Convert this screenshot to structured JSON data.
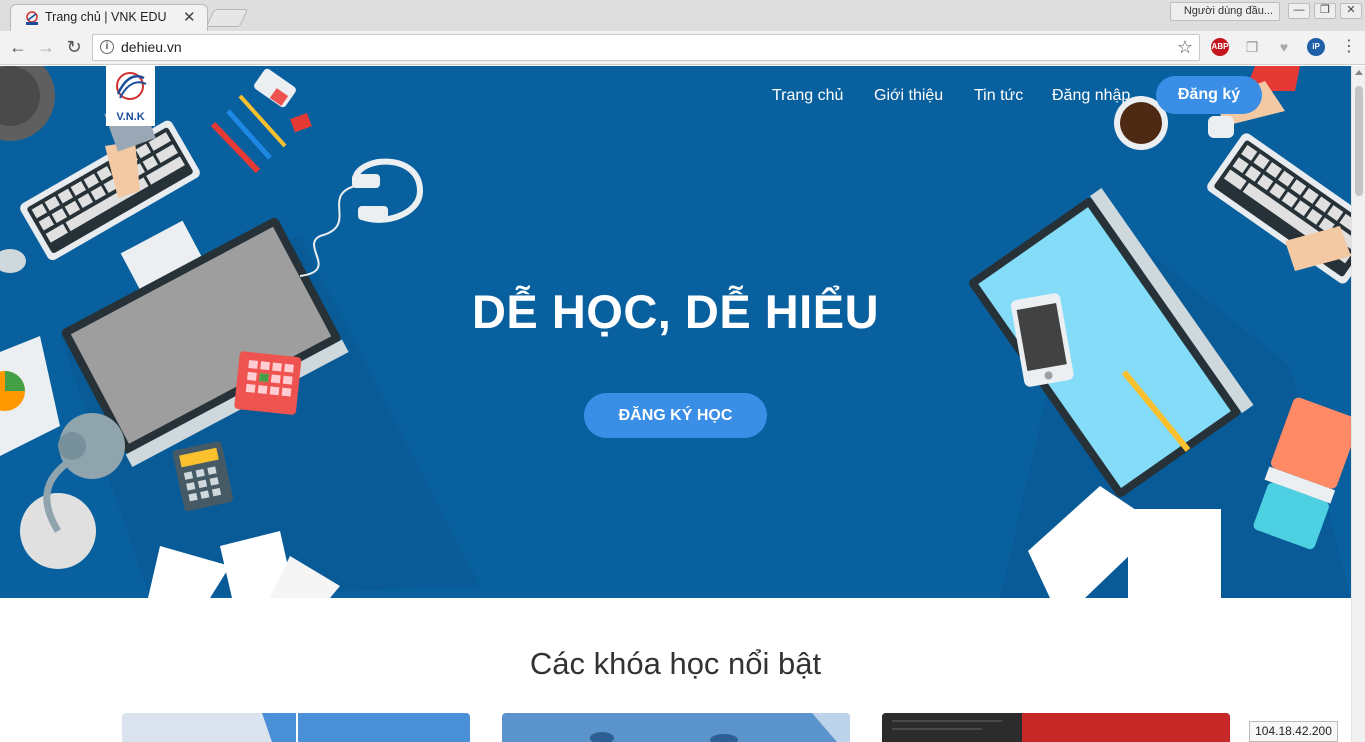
{
  "browser": {
    "tab_title": "Trang chủ | VNK EDU",
    "tab_close": "✕",
    "profile_label": "Người dùng đầu...",
    "url": "dehieu.vn",
    "window_buttons": [
      "—",
      "❐",
      "✕"
    ],
    "extensions": [
      {
        "name": "adblock-plus-icon",
        "label": "ABP",
        "color": "#c4161c"
      },
      {
        "name": "bookmark-ext-icon",
        "label": "",
        "color": "#9e9e9e"
      },
      {
        "name": "heart-ext-icon",
        "label": "",
        "color": "#9e9e9e"
      },
      {
        "name": "ip-ext-icon",
        "label": "iP",
        "color": "#1f5fa8"
      }
    ]
  },
  "site": {
    "logo_text": "V.N.K",
    "nav": [
      "Trang chủ",
      "Giới thiệu",
      "Tin tức",
      "Đăng nhập"
    ],
    "register_button": "Đăng ký",
    "hero_title": "DỄ HỌC, DỄ HIỂU",
    "hero_cta": "ĐĂNG KÝ HỌC",
    "section_title": "Các khóa học nổi bật"
  },
  "status": {
    "ip": "104.18.42.200"
  },
  "colors": {
    "hero_bg": "#08609f",
    "button_blue": "#3a8ee6"
  }
}
